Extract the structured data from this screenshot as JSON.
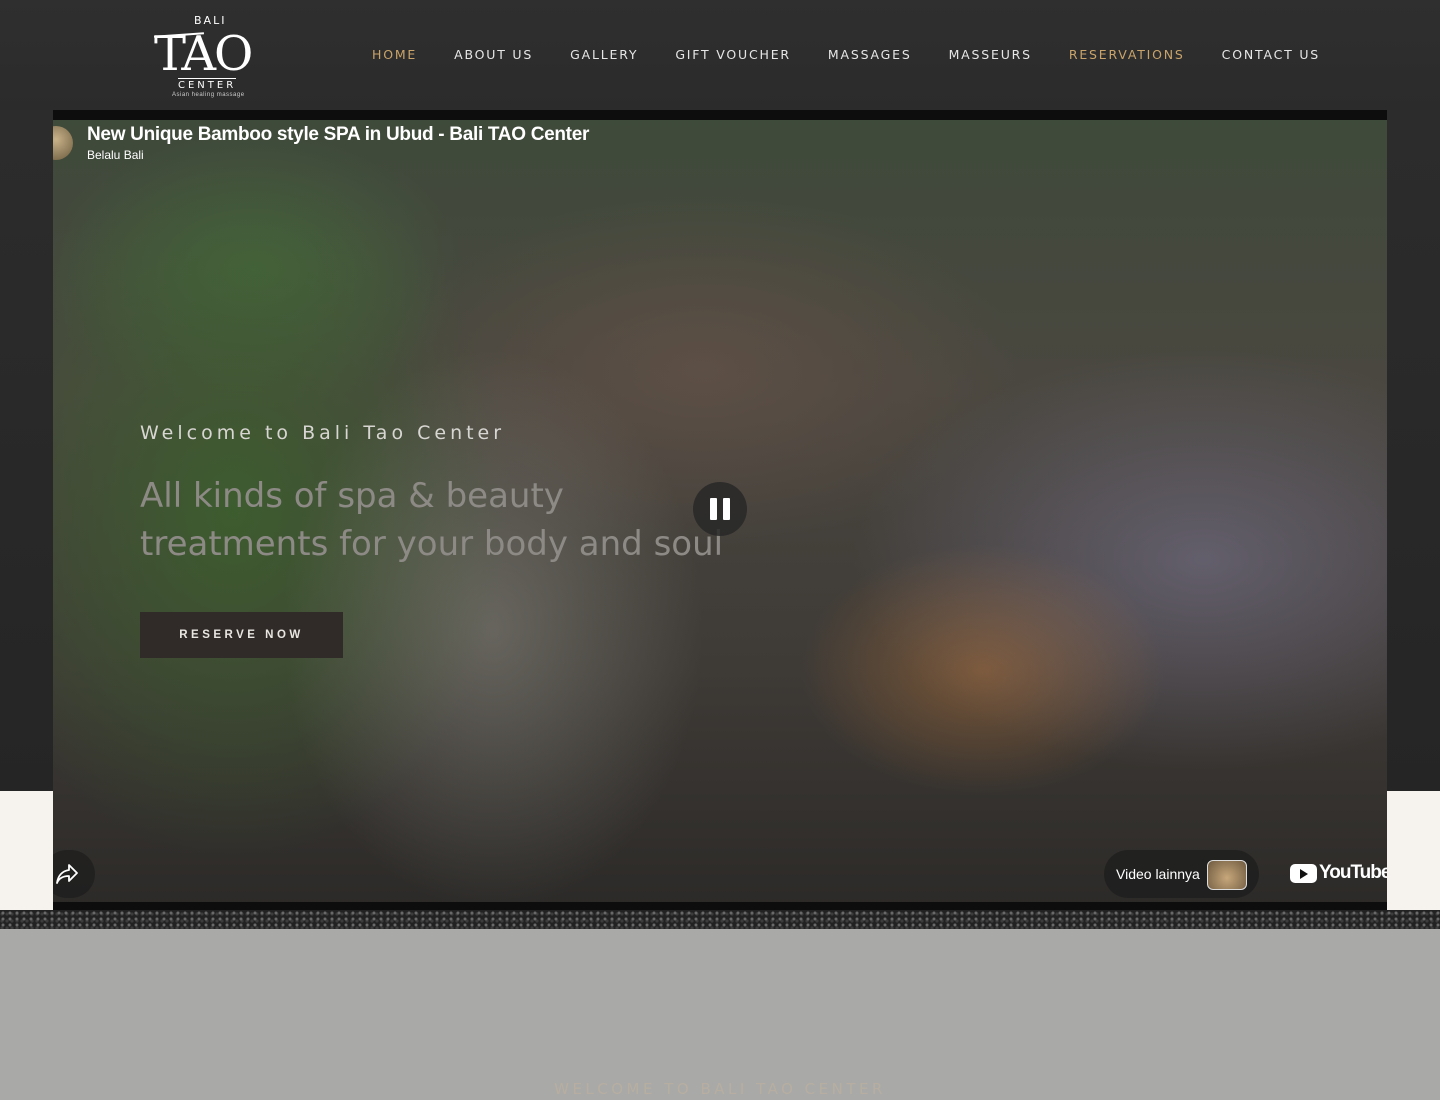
{
  "brand": {
    "logo_top": "BALI",
    "logo_main": "TAO",
    "logo_center": "CENTER",
    "logo_sub": "Asian healing massage"
  },
  "nav": {
    "items": [
      "HOME",
      "ABOUT US",
      "GALLERY",
      "GIFT VOUCHER",
      "MASSAGES",
      "MASSEURS",
      "RESERVATIONS",
      "CONTACT US"
    ],
    "home_color": "#c9a36a",
    "reservations_color": "#c9a36a"
  },
  "video": {
    "title": "New Unique Bamboo style SPA in Ubud - Bali TAO Center",
    "channel": "Belalu Bali",
    "more_videos": "Video lainnya",
    "youtube_wordmark": "YouTube",
    "state": "playing"
  },
  "hero": {
    "welcome": "Welcome to Bali Tao Center",
    "headline": "All kinds of spa & beauty treatments for your body and soul",
    "cta": "RESERVE NOW"
  },
  "section": {
    "welcome": "WELCOME TO BALI TAO CENTER"
  },
  "colors": {
    "header_bg": "#2e2e2e",
    "accent": "#c9a36a",
    "page_bg": "#a9a9a7"
  }
}
